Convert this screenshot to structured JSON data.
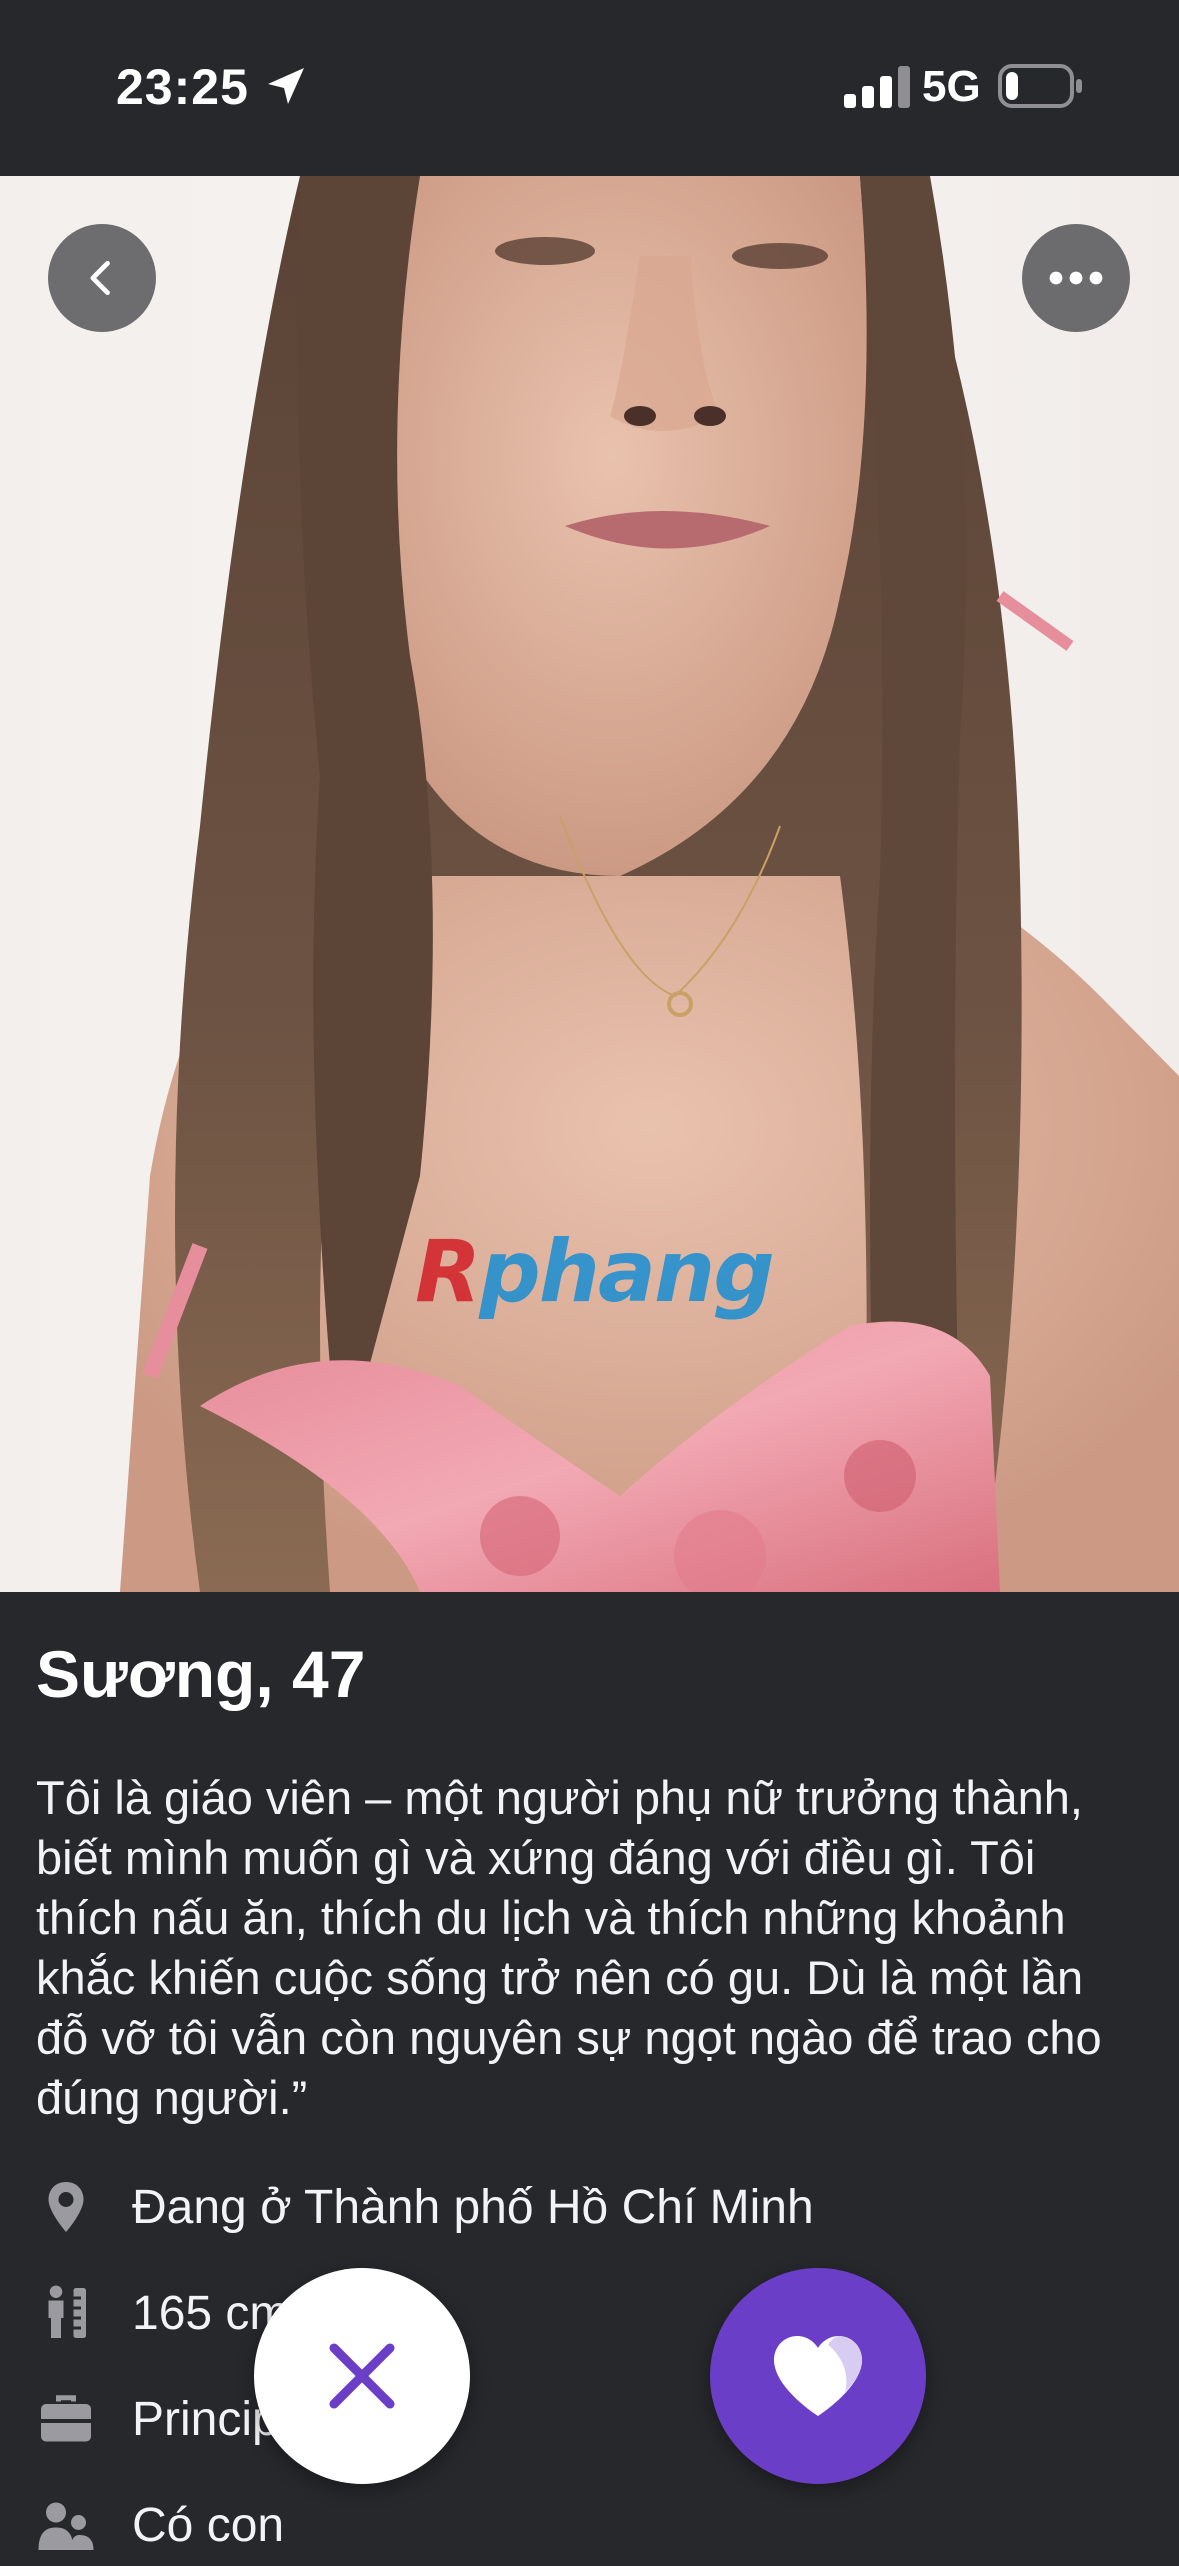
{
  "status_bar": {
    "time": "23:25",
    "network": "5G"
  },
  "watermark": {
    "first_letter": "R",
    "rest": "phang"
  },
  "profile": {
    "name_age": "Sương, 47",
    "bio": "Tôi là giáo viên – một người phụ nữ trưởng thành, biết mình muốn gì và xứng đáng với điều gì. Tôi thích nấu ăn, thích du lịch và thích những khoảnh khắc khiến cuộc sống trở nên có gu. Dù là một lần đỗ vỡ  tôi vẫn còn nguyên sự ngọt ngào để trao cho đúng người.”",
    "details": {
      "location": "Đang ở Thành phố Hồ Chí Minh",
      "height": "165 cm",
      "job": "Princip",
      "children": "Có con"
    }
  },
  "icons": {
    "back": "chevron-left-icon",
    "more": "more-horizontal-icon",
    "location": "map-pin-icon",
    "height": "ruler-person-icon",
    "job": "briefcase-icon",
    "children": "people-icon",
    "dislike": "close-icon",
    "like": "heart-icon"
  },
  "colors": {
    "background": "#27282c",
    "accent": "#6a3ec6",
    "watermark_red": "#d2232a",
    "watermark_blue": "#1f8fd1"
  }
}
